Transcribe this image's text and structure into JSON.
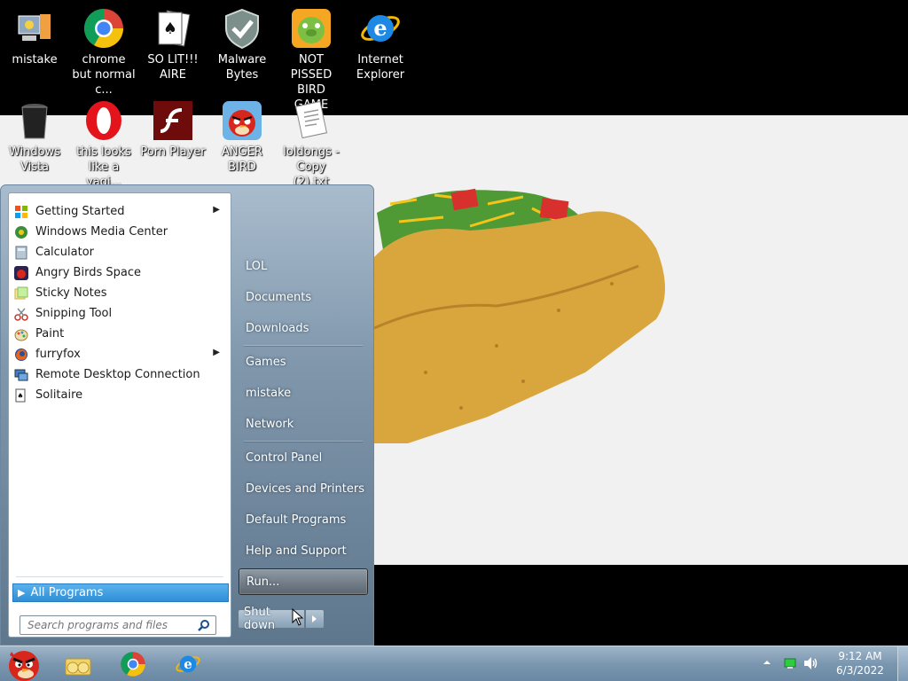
{
  "desktop": {
    "icons": [
      {
        "label": "mistake",
        "icon": "computer-user-icon"
      },
      {
        "label": "chrome but normal c...",
        "icon": "chrome-icon"
      },
      {
        "label": "SO LIT!!! AIRE",
        "icon": "solitaire-cards-icon"
      },
      {
        "label": "Malware Bytes",
        "icon": "shield-check-icon"
      },
      {
        "label": "NOT PISSED BIRD GAME",
        "icon": "green-pig-icon"
      },
      {
        "label": "Internet Explorer",
        "icon": "internet-explorer-icon"
      },
      {
        "label": "Windows Vista",
        "icon": "recycle-bin-icon"
      },
      {
        "label": "this looks like a vagi...",
        "icon": "opera-icon"
      },
      {
        "label": "Porn Player",
        "icon": "flash-player-icon"
      },
      {
        "label": "ANGER BIRD",
        "icon": "angry-bird-icon"
      },
      {
        "label": "loldongs - Copy (2).txt",
        "icon": "text-file-icon"
      }
    ]
  },
  "start_menu": {
    "programs": [
      {
        "label": "Getting Started",
        "icon": "getting-started-icon",
        "submenu": true
      },
      {
        "label": "Windows Media Center",
        "icon": "media-center-icon",
        "submenu": false
      },
      {
        "label": "Calculator",
        "icon": "calculator-icon",
        "submenu": false
      },
      {
        "label": "Angry Birds Space",
        "icon": "angry-birds-space-icon",
        "submenu": false
      },
      {
        "label": "Sticky Notes",
        "icon": "sticky-notes-icon",
        "submenu": false
      },
      {
        "label": "Snipping Tool",
        "icon": "snipping-tool-icon",
        "submenu": false
      },
      {
        "label": "Paint",
        "icon": "paint-icon",
        "submenu": false
      },
      {
        "label": "furryfox",
        "icon": "firefox-icon",
        "submenu": true
      },
      {
        "label": "Remote Desktop Connection",
        "icon": "remote-desktop-icon",
        "submenu": false
      },
      {
        "label": "Solitaire",
        "icon": "solitaire-icon",
        "submenu": false
      }
    ],
    "all_programs": "All Programs",
    "search_placeholder": "Search programs and files",
    "places": [
      {
        "label": "LOL"
      },
      {
        "label": "Documents"
      },
      {
        "label": "Downloads"
      },
      {
        "label": "Games"
      },
      {
        "label": "mistake"
      },
      {
        "label": "Network"
      },
      {
        "label": "Control Panel"
      },
      {
        "label": "Devices and Printers"
      },
      {
        "label": "Default Programs"
      },
      {
        "label": "Help and Support"
      },
      {
        "label": "Run..."
      }
    ],
    "shutdown_label": "Shut down"
  },
  "taskbar": {
    "pinned": [
      {
        "icon": "angry-bird-start-orb-icon"
      },
      {
        "icon": "libraries-folder-icon"
      },
      {
        "icon": "chrome-icon"
      },
      {
        "icon": "internet-explorer-icon"
      }
    ],
    "tray": {
      "time": "9:12 AM",
      "date": "6/3/2022"
    }
  },
  "colors": {
    "accent": "#2f8ed6",
    "taskbar": "#7b97b0",
    "desktop_background": "#000000",
    "wallpaper": "#f1f1f1"
  }
}
